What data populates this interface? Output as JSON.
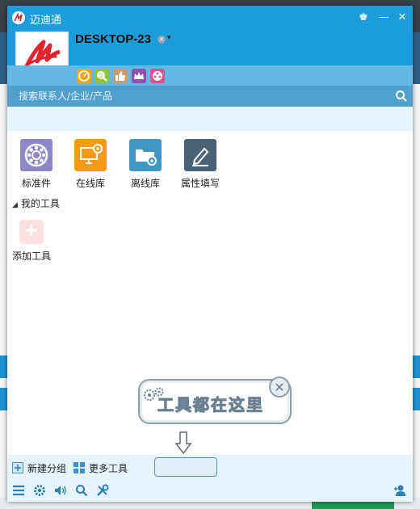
{
  "app": {
    "name": "迈迪通"
  },
  "window_controls": {
    "skin": "♚",
    "minimize": "—",
    "close": "✕"
  },
  "user": {
    "name": "DESKTOP-23",
    "status_caret": "▾",
    "status_mark": "×"
  },
  "search": {
    "placeholder": "搜索联系人/企业/产品"
  },
  "tools": [
    {
      "label": "标准件",
      "color": "#8f88c8"
    },
    {
      "label": "在线库",
      "color": "#f39b16"
    },
    {
      "label": "离线库",
      "color": "#3f97c3"
    },
    {
      "label": "属性填写",
      "color": "#4a6276"
    }
  ],
  "my_tools": {
    "heading": "我的工具",
    "add_label": "添加工具",
    "add_symbol": "+"
  },
  "tooltip": {
    "text": "工具都在这里",
    "close_symbol": "✕"
  },
  "footer": {
    "new_group": "新建分组",
    "more_tools": "更多工具"
  },
  "icons": {
    "app_row": [
      "orange-gauge-icon",
      "green-enterprise-icon",
      "thumb-icon",
      "crown-icon",
      "film-icon"
    ],
    "bottom": [
      "menu-icon",
      "settings-icon",
      "volume-icon",
      "search-icon",
      "tools-icon",
      "add-contact-icon"
    ]
  },
  "colors": {
    "titlebar": "#1b9ddc",
    "accent": "#4fa0cc"
  }
}
